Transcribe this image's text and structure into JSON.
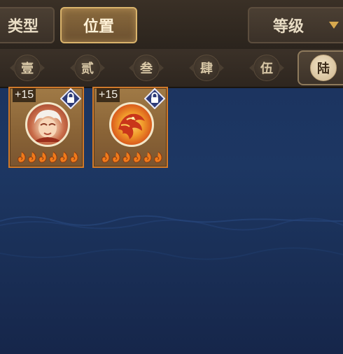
{
  "tabs": {
    "type": "类型",
    "position": "位置",
    "level": "等级"
  },
  "filters": [
    "壹",
    "贰",
    "叁",
    "肆",
    "伍",
    "陆"
  ],
  "active_filter": "陆",
  "heroes": [
    {
      "plus": "+15",
      "portrait": "white-haired-hero",
      "stars": 6,
      "locked": true
    },
    {
      "plus": "+15",
      "portrait": "phoenix",
      "stars": 6,
      "locked": true
    }
  ],
  "colors": {
    "accent": "#d9b36b",
    "card_border": "#d07a2a",
    "star": "#f07a1a",
    "lock_badge": "#3b4a8c"
  }
}
